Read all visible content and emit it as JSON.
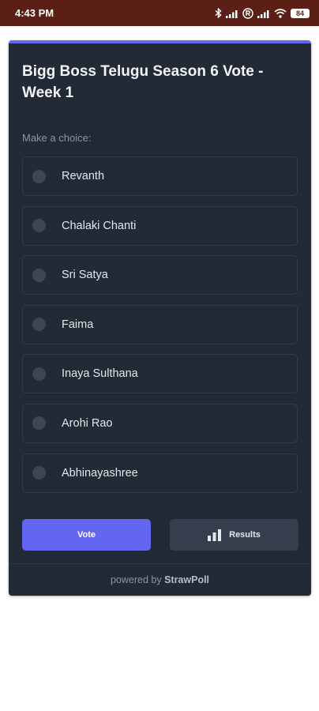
{
  "status_bar": {
    "time": "4:43 PM",
    "battery": "84",
    "icons": [
      "bluetooth-icon",
      "signal-icon",
      "registered-icon",
      "signal-icon",
      "wifi-icon",
      "battery-icon"
    ]
  },
  "poll": {
    "title": "Bigg Boss Telugu Season 6 Vote - Week 1",
    "prompt": "Make a choice:",
    "options": [
      {
        "label": "Revanth"
      },
      {
        "label": "Chalaki Chanti"
      },
      {
        "label": "Sri Satya"
      },
      {
        "label": "Faima"
      },
      {
        "label": "Inaya Sulthana"
      },
      {
        "label": "Arohi Rao"
      },
      {
        "label": "Abhinayashree"
      }
    ],
    "vote_label": "Vote",
    "results_label": "Results",
    "results_icon": "bar-chart-icon"
  },
  "footer": {
    "prefix": "powered by",
    "brand": "StrawPoll"
  },
  "colors": {
    "status_bar": "#5b1f15",
    "card_background": "#222a36",
    "accent": "#6366f1",
    "secondary_button": "#353e4c"
  }
}
